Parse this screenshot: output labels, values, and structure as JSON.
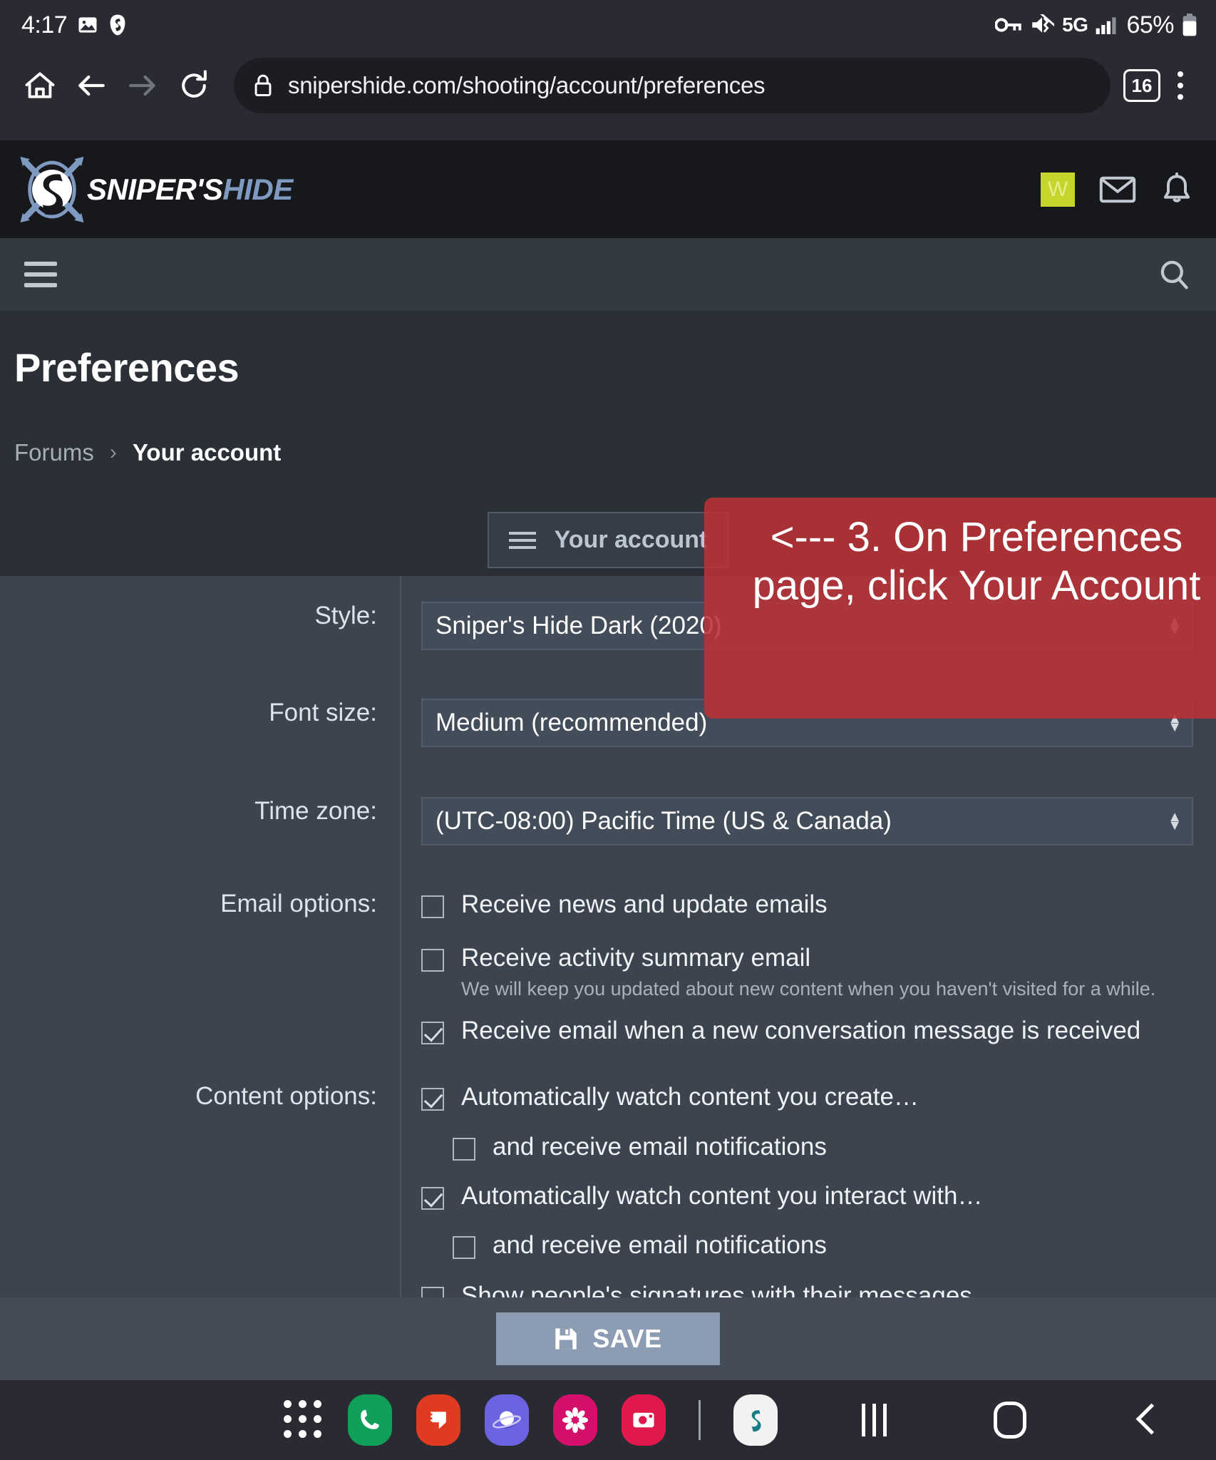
{
  "statusbar": {
    "time": "4:17",
    "network_label": "5G",
    "battery_percent": "65%",
    "icons": [
      "image-icon",
      "surfshark-icon",
      "vpn-key-icon",
      "mute-vibrate-icon",
      "signal-bars-icon",
      "battery-icon"
    ]
  },
  "browser": {
    "url": "snipershide.com/shooting/account/preferences",
    "tab_count": "16",
    "buttons": [
      "home-icon",
      "back-icon",
      "forward-icon",
      "reload-icon",
      "lock-icon",
      "tab-switcher",
      "menu-icon"
    ]
  },
  "site_header": {
    "brand_primary": "SNIPER'S",
    "brand_secondary": "HIDE",
    "avatar_initial": "W",
    "icons": [
      "envelope-icon",
      "bell-icon"
    ]
  },
  "subnav": {
    "menu_icon": "hamburger-icon",
    "search_icon": "search-icon"
  },
  "page": {
    "title": "Preferences",
    "breadcrumb": {
      "root": "Forums",
      "separator": "›",
      "current": "Your account"
    },
    "account_tab_label": "Your account"
  },
  "annotation": {
    "text": "<--- 3. On Preferences page, click Your Account",
    "color": "#ba3236"
  },
  "form": {
    "style": {
      "label": "Style:",
      "value": "Sniper's Hide Dark (2020)"
    },
    "font_size": {
      "label": "Font size:",
      "value": "Medium (recommended)"
    },
    "time_zone": {
      "label": "Time zone:",
      "value": "(UTC-08:00) Pacific Time (US & Canada)"
    },
    "email_options": {
      "label": "Email options:",
      "items": [
        {
          "text": "Receive news and update emails",
          "checked": false,
          "help": ""
        },
        {
          "text": "Receive activity summary email",
          "checked": false,
          "help": "We will keep you updated about new content when you haven't visited for a while."
        },
        {
          "text": "Receive email when a new conversation message is received",
          "checked": true,
          "help": ""
        }
      ]
    },
    "content_options": {
      "label": "Content options:",
      "items": [
        {
          "text": "Automatically watch content you create…",
          "checked": true,
          "indent": false
        },
        {
          "text": "and receive email notifications",
          "checked": false,
          "indent": true
        },
        {
          "text": "Automatically watch content you interact with…",
          "checked": true,
          "indent": false
        },
        {
          "text": "and receive email notifications",
          "checked": false,
          "indent": true
        },
        {
          "text": "Show people's signatures with their messages",
          "checked": false,
          "indent": false
        }
      ]
    }
  },
  "save_bar": {
    "label": "SAVE",
    "icon": "floppy-disk-icon"
  },
  "dock": {
    "apps": [
      {
        "name": "app-drawer-icon",
        "color": "#2a2a33"
      },
      {
        "name": "phone-icon",
        "color": "#10a05a"
      },
      {
        "name": "messages-icon",
        "color": "#e03a20"
      },
      {
        "name": "samsung-internet-icon",
        "color": "#6c63e0"
      },
      {
        "name": "gallery-icon",
        "color": "#d4106a"
      },
      {
        "name": "camera-icon",
        "color": "#e0184b"
      },
      {
        "name": "surfshark-icon",
        "color": "#f2f2f2"
      }
    ],
    "system_nav": [
      "recents-button",
      "home-button",
      "back-button"
    ]
  }
}
